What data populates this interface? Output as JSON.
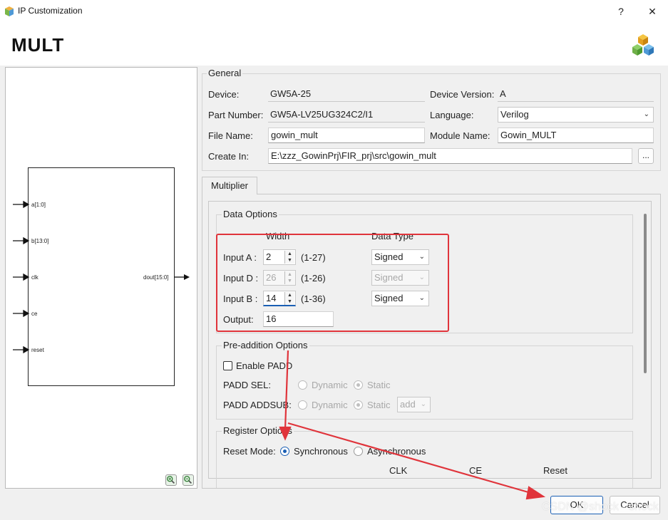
{
  "window": {
    "title": "IP Customization",
    "help_label": "?",
    "close_label": "✕"
  },
  "header": {
    "title": "MULT"
  },
  "diagram": {
    "inputs": [
      "a[1:0]",
      "b[13:0]",
      "clk",
      "ce",
      "reset"
    ],
    "output": "dout[15:0]"
  },
  "general": {
    "group_title": "General",
    "device_label": "Device:",
    "device_value": "GW5A-25",
    "device_version_label": "Device Version:",
    "device_version_value": "A",
    "part_number_label": "Part Number:",
    "part_number_value": "GW5A-LV25UG324C2/I1",
    "language_label": "Language:",
    "language_value": "Verilog",
    "file_name_label": "File Name:",
    "file_name_value": "gowin_mult",
    "module_name_label": "Module Name:",
    "module_name_value": "Gowin_MULT",
    "create_in_label": "Create In:",
    "create_in_value": "E:\\zzz_GowinPrj\\FIR_prj\\src\\gowin_mult",
    "browse_label": "..."
  },
  "tab": {
    "label": "Multiplier"
  },
  "data_options": {
    "group_title": "Data Options",
    "width_header": "Width",
    "data_type_header": "Data Type",
    "rows": [
      {
        "label": "Input A :",
        "value": "2",
        "range": "(1-27)",
        "type": "Signed",
        "enabled": true
      },
      {
        "label": "Input D :",
        "value": "26",
        "range": "(1-26)",
        "type": "Signed",
        "enabled": false
      },
      {
        "label": "Input B :",
        "value": "14",
        "range": "(1-36)",
        "type": "Signed",
        "enabled": true
      }
    ],
    "output_label": "Output:",
    "output_value": "16"
  },
  "pre_addition": {
    "group_title": "Pre-addition Options",
    "enable_padd_label": "Enable PADD",
    "padd_sel_label": "PADD SEL:",
    "padd_addsub_label": "PADD ADDSUB:",
    "dynamic_label": "Dynamic",
    "static_label": "Static",
    "addsub_value": "add"
  },
  "register": {
    "group_title": "Register Options",
    "reset_mode_label": "Reset Mode:",
    "synchronous_label": "Synchronous",
    "asynchronous_label": "Asynchronous",
    "col_clk": "CLK",
    "col_ce": "CE",
    "col_reset": "Reset"
  },
  "buttons": {
    "ok_label": "OK",
    "cancel_label": "Cancel"
  },
  "watermark": "CSDN @shock - shock",
  "colors": {
    "annotation_red": "#e0343b",
    "accent_blue": "#1a5fb4"
  }
}
